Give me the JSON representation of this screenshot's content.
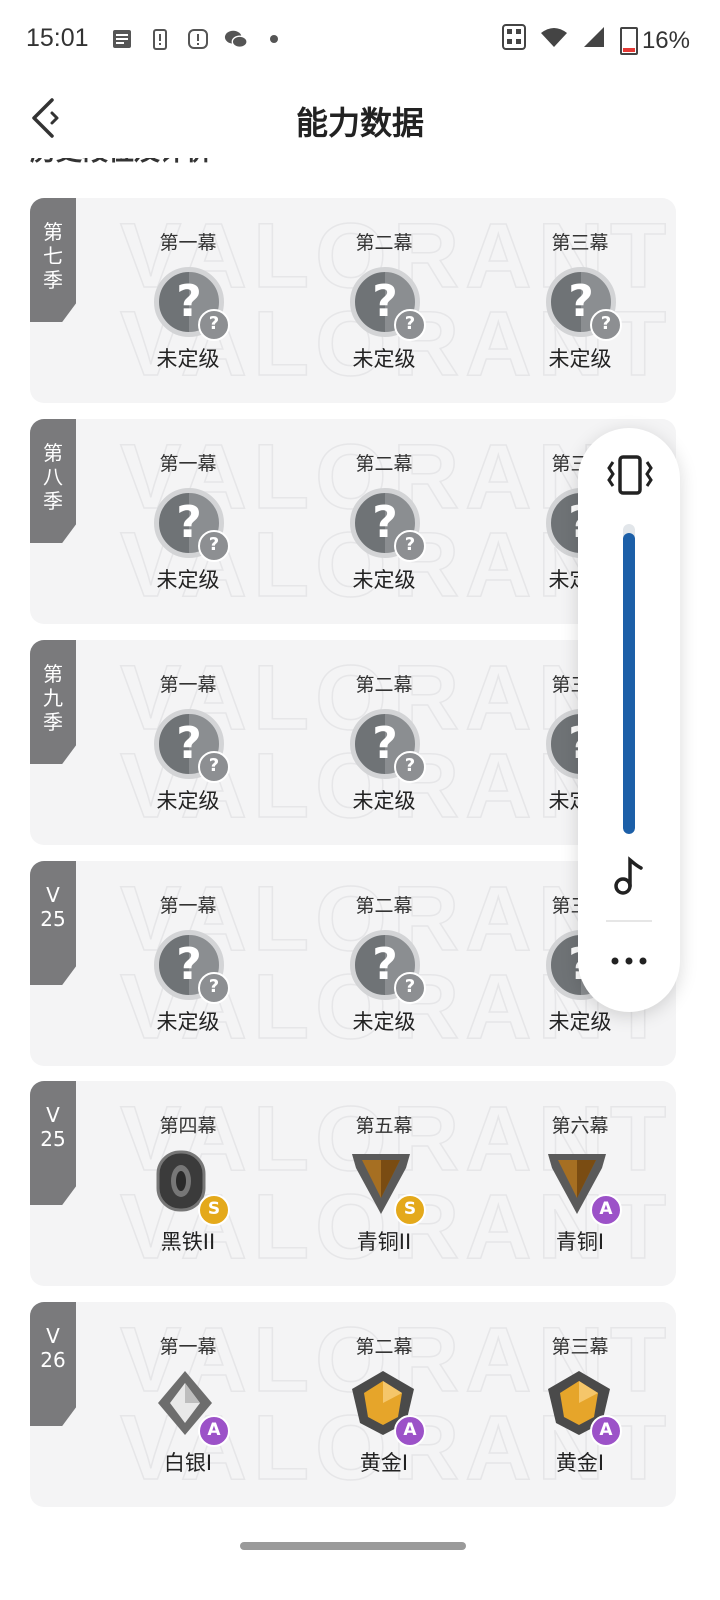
{
  "status_bar": {
    "time": "15:01",
    "battery": "16%"
  },
  "header": {
    "title": "能力数据"
  },
  "section_title": "历史段位及评价",
  "watermark": "VALORANT",
  "cards": [
    {
      "tag": [
        "第",
        "七",
        "季"
      ],
      "acts": [
        {
          "act": "第一幕",
          "rank": "未定级",
          "badge": "?"
        },
        {
          "act": "第二幕",
          "rank": "未定级",
          "badge": "?"
        },
        {
          "act": "第三幕",
          "rank": "未定级",
          "badge": "?"
        }
      ]
    },
    {
      "tag": [
        "第",
        "八",
        "季"
      ],
      "acts": [
        {
          "act": "第一幕",
          "rank": "未定级",
          "badge": "?"
        },
        {
          "act": "第二幕",
          "rank": "未定级",
          "badge": "?"
        },
        {
          "act": "第三幕",
          "rank": "未定级",
          "badge": "?"
        }
      ]
    },
    {
      "tag": [
        "第",
        "九",
        "季"
      ],
      "acts": [
        {
          "act": "第一幕",
          "rank": "未定级",
          "badge": "?"
        },
        {
          "act": "第二幕",
          "rank": "未定级",
          "badge": "?"
        },
        {
          "act": "第三幕",
          "rank": "未定级",
          "badge": "?"
        }
      ]
    },
    {
      "tag": [
        "V",
        "25"
      ],
      "acts": [
        {
          "act": "第一幕",
          "rank": "未定级",
          "badge": "?"
        },
        {
          "act": "第二幕",
          "rank": "未定级",
          "badge": "?"
        },
        {
          "act": "第三幕",
          "rank": "未定级",
          "badge": "?"
        }
      ]
    },
    {
      "tag": [
        "V",
        "25"
      ],
      "acts": [
        {
          "act": "第四幕",
          "rank": "黑铁II",
          "badge": "S",
          "emblem": "iron"
        },
        {
          "act": "第五幕",
          "rank": "青铜II",
          "badge": "S",
          "emblem": "bronze"
        },
        {
          "act": "第六幕",
          "rank": "青铜I",
          "badge": "A",
          "emblem": "bronze"
        }
      ]
    },
    {
      "tag": [
        "V",
        "26"
      ],
      "acts": [
        {
          "act": "第一幕",
          "rank": "白银I",
          "badge": "A",
          "emblem": "silver"
        },
        {
          "act": "第二幕",
          "rank": "黄金I",
          "badge": "A",
          "emblem": "gold"
        },
        {
          "act": "第三幕",
          "rank": "黄金I",
          "badge": "A",
          "emblem": "gold"
        }
      ]
    }
  ],
  "volume_panel": {
    "level": 0.97,
    "more_label": "..."
  },
  "colors": {
    "vol_fill": "#1c5fa8",
    "tag_bg": "#7a7a7c",
    "card_bg": "#f4f4f5",
    "badge_s": "#e4a91b",
    "badge_a": "#9c52c8"
  }
}
